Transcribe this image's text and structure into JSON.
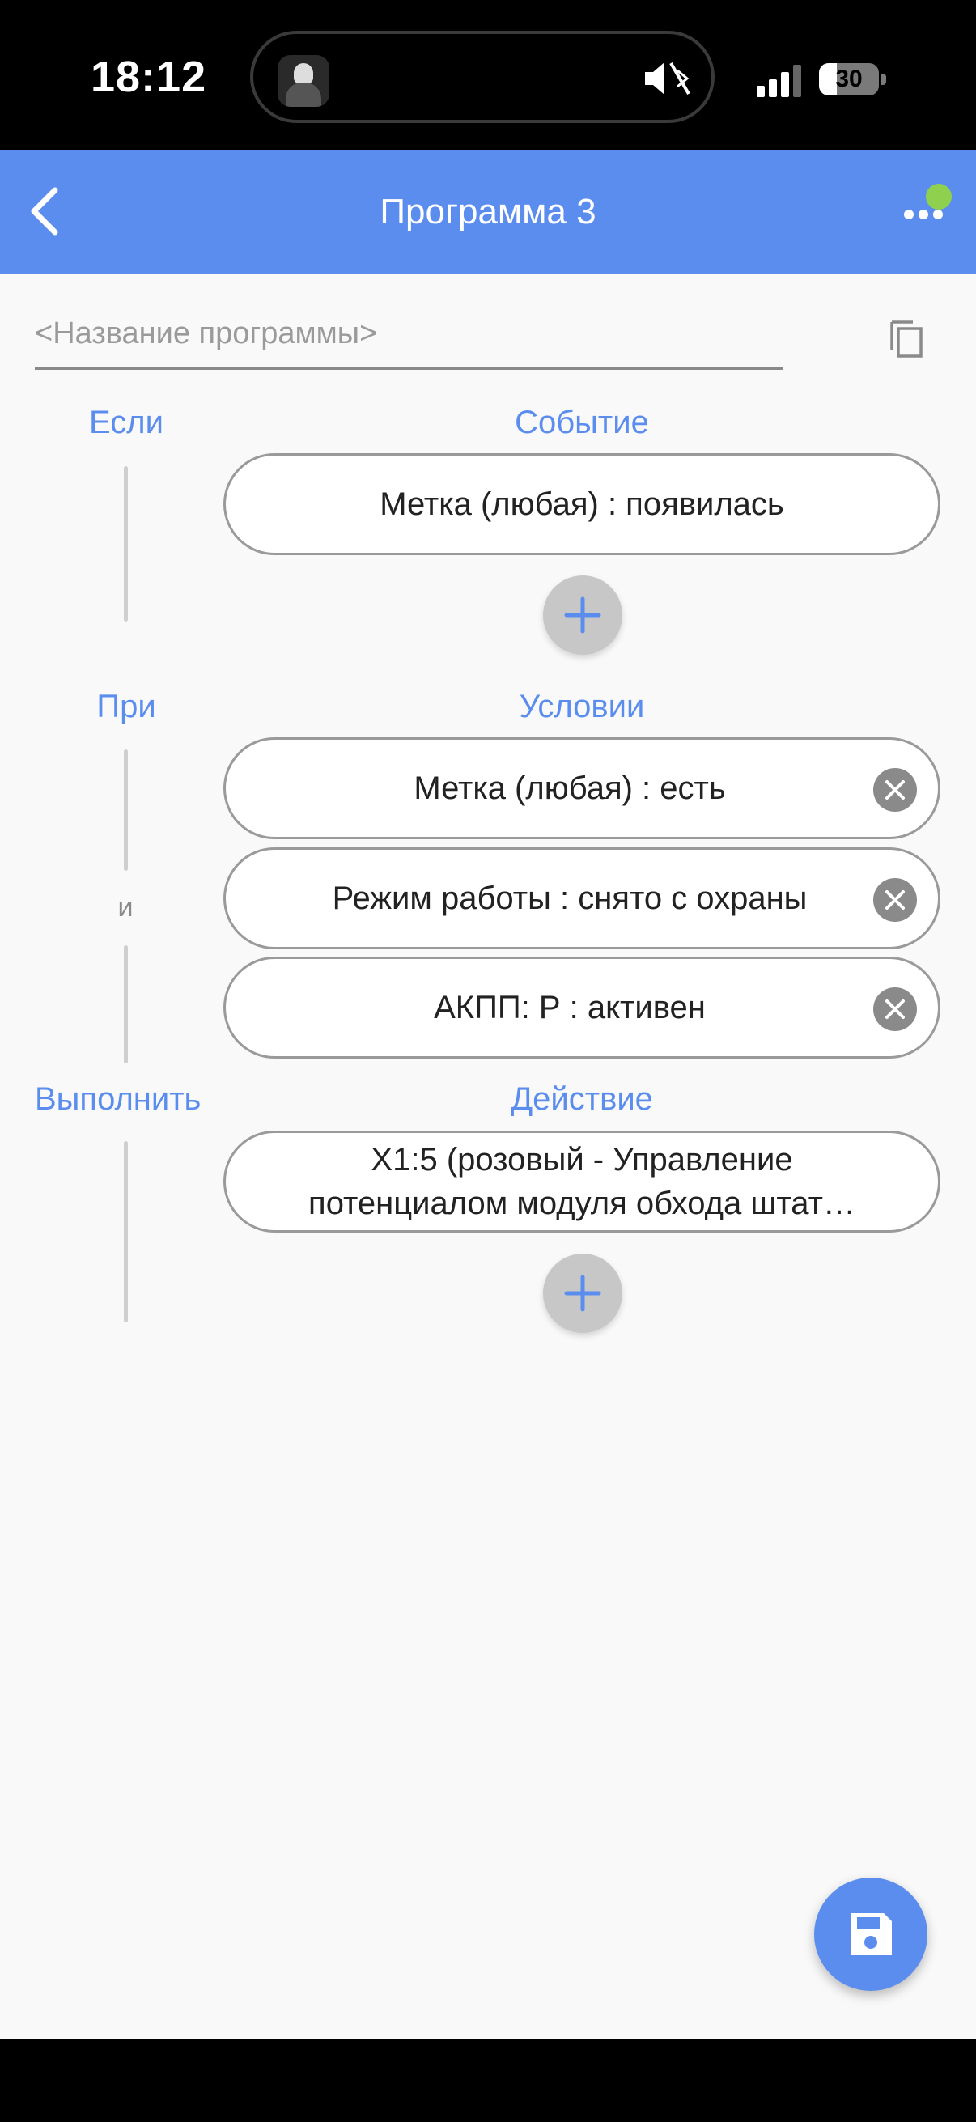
{
  "status_bar": {
    "time": "18:12",
    "battery_level": "30",
    "battery_fraction": 0.3
  },
  "header": {
    "title": "Программа 3",
    "back_icon": "chevron-left-icon",
    "more_icon": "more-horizontal-icon",
    "indicator_color": "#8fd14f"
  },
  "program": {
    "name_placeholder": "<Название программы>",
    "name_value": "",
    "copy_icon": "copy-icon"
  },
  "sections": {
    "if_label": "Если",
    "event_title": "Событие",
    "when_label": "При",
    "condition_title": "Условии",
    "and_label": "и",
    "execute_label": "Выполнить",
    "action_title": "Действие"
  },
  "events": [
    {
      "label": "Метка (любая) : появилась"
    }
  ],
  "conditions": [
    {
      "label": "Метка (любая) : есть"
    },
    {
      "label": "Режим работы : снято с охраны"
    },
    {
      "label": "АКПП: Р : активен"
    }
  ],
  "actions": [
    {
      "line1": "X1:5 (розовый - Управление",
      "line2": "потенциалом модуля обхода штат…"
    }
  ],
  "colors": {
    "accent": "#5b8def",
    "add_button": "#c7c7c7",
    "remove_button": "#8a8a8a"
  }
}
